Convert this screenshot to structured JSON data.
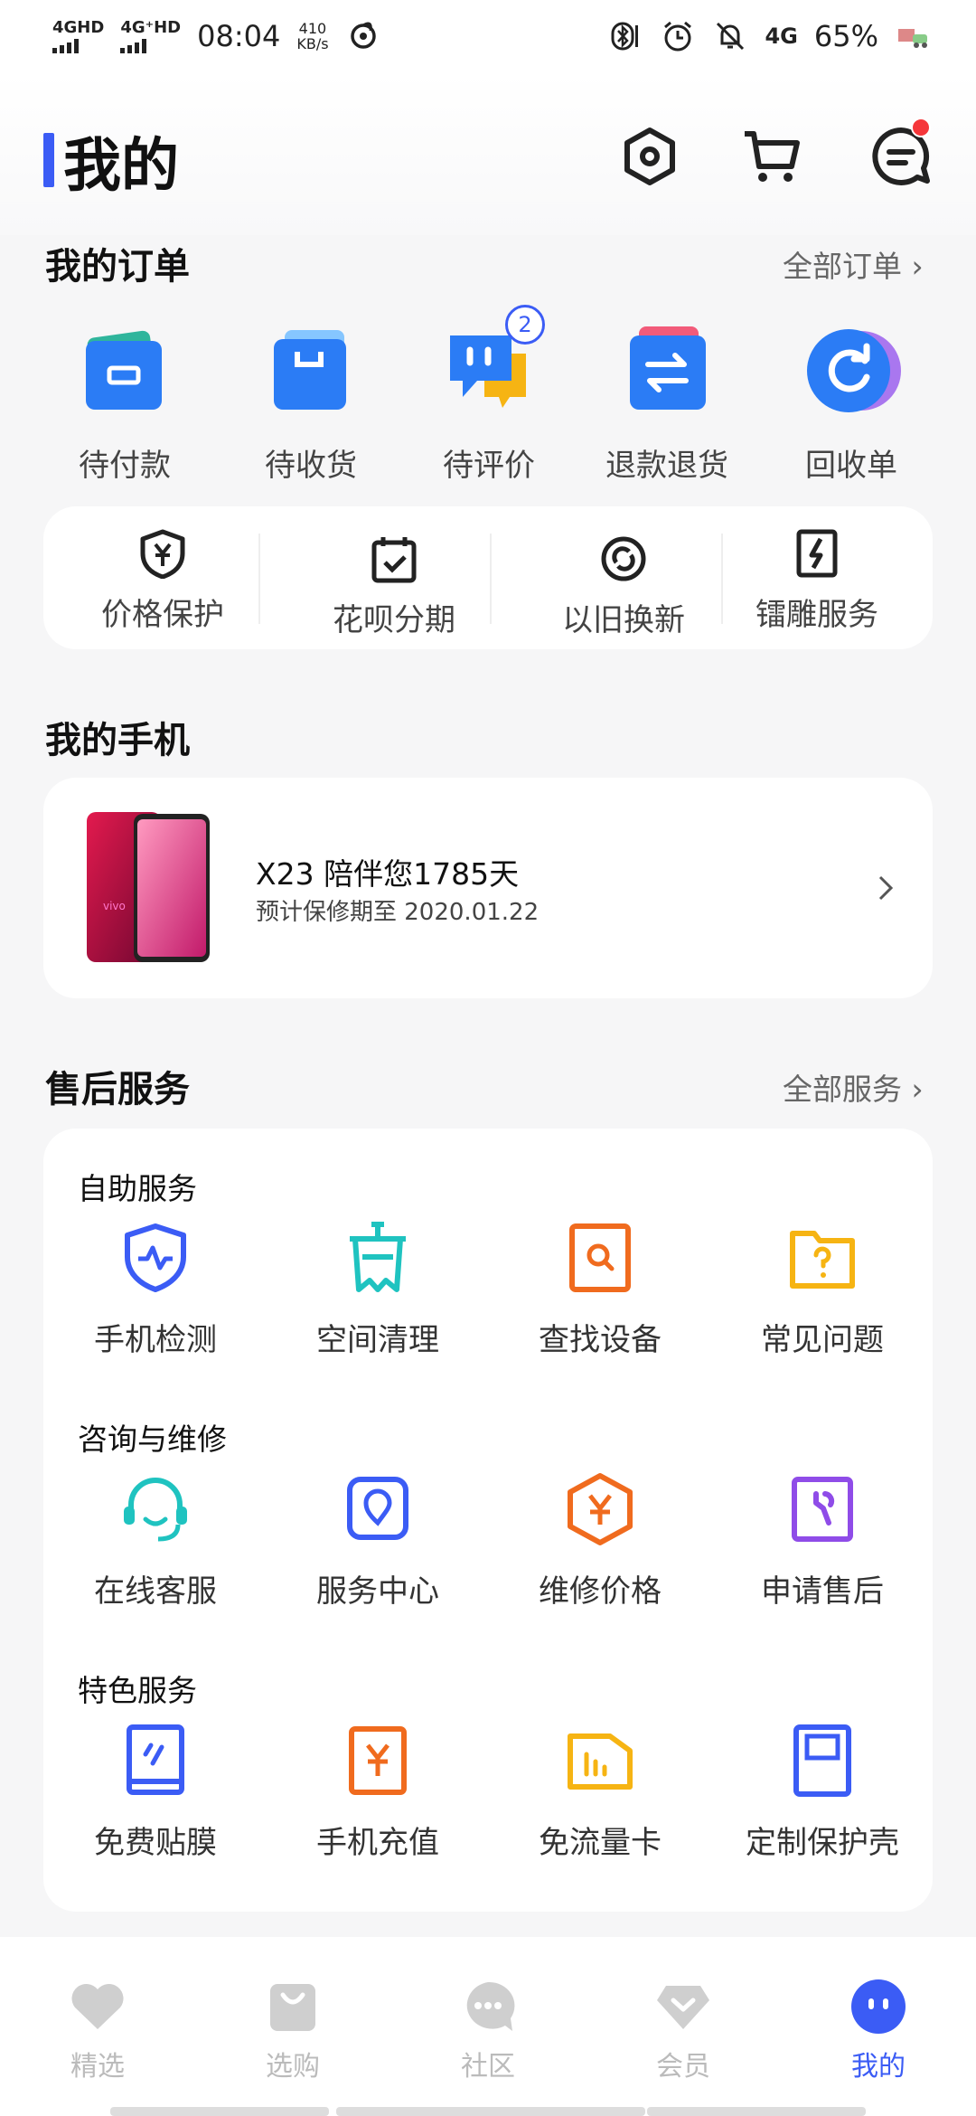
{
  "status_bar": {
    "signal1": "4GHD",
    "signal2": "4G⁺HD",
    "time": "08:04",
    "net_speed_value": "410",
    "net_speed_unit": "KB/s",
    "network_type": "4G",
    "battery": "65%"
  },
  "header": {
    "title": "我的",
    "icons": [
      "settings-hexagon-icon",
      "cart-icon",
      "message-icon"
    ]
  },
  "orders": {
    "title": "我的订单",
    "all_link": "全部订单 ›",
    "items": [
      {
        "label": "待付款",
        "icon": "wallet-icon"
      },
      {
        "label": "待收货",
        "icon": "package-icon"
      },
      {
        "label": "待评价",
        "icon": "comment-icon",
        "badge": "2"
      },
      {
        "label": "退款退货",
        "icon": "refund-icon"
      },
      {
        "label": "回收单",
        "icon": "recycle-icon"
      }
    ]
  },
  "services_row": [
    {
      "label": "价格保护",
      "icon": "shield-yen-icon"
    },
    {
      "label": "花呗分期",
      "icon": "calendar-check-icon"
    },
    {
      "label": "以旧换新",
      "icon": "trade-in-icon"
    },
    {
      "label": "镭雕服务",
      "icon": "laser-icon"
    }
  ],
  "my_phone": {
    "title": "我的手机",
    "name_line": "X23 陪伴您1785天",
    "warranty_line": "预计保修期至 2020.01.22"
  },
  "after_sales": {
    "title": "售后服务",
    "all_link": "全部服务 ›",
    "groups": [
      {
        "title": "自助服务",
        "items": [
          {
            "label": "手机检测",
            "icon": "phone-check-icon"
          },
          {
            "label": "空间清理",
            "icon": "clean-icon"
          },
          {
            "label": "查找设备",
            "icon": "find-device-icon"
          },
          {
            "label": "常见问题",
            "icon": "faq-folder-icon"
          }
        ]
      },
      {
        "title": "咨询与维修",
        "items": [
          {
            "label": "在线客服",
            "icon": "headset-icon"
          },
          {
            "label": "服务中心",
            "icon": "location-icon"
          },
          {
            "label": "维修价格",
            "icon": "price-icon"
          },
          {
            "label": "申请售后",
            "icon": "wrench-icon"
          }
        ]
      },
      {
        "title": "特色服务",
        "items": [
          {
            "label": "免费贴膜",
            "icon": "screen-film-icon"
          },
          {
            "label": "手机充值",
            "icon": "recharge-icon"
          },
          {
            "label": "免流量卡",
            "icon": "sim-card-icon"
          },
          {
            "label": "定制保护壳",
            "icon": "case-icon"
          }
        ]
      }
    ]
  },
  "bottom_nav": [
    {
      "label": "精选",
      "icon": "heart-icon",
      "active": false
    },
    {
      "label": "选购",
      "icon": "bag-icon",
      "active": false
    },
    {
      "label": "社区",
      "icon": "chat-bubble-icon",
      "active": false
    },
    {
      "label": "会员",
      "icon": "diamond-icon",
      "active": false
    },
    {
      "label": "我的",
      "icon": "profile-face-icon",
      "active": true
    }
  ],
  "colors": {
    "accent": "#3b5cf5",
    "badge_red": "#f5363a",
    "teal": "#1fc3c0",
    "orange": "#f06b1e",
    "yellow": "#f6b413",
    "purple": "#8f4ce8"
  }
}
